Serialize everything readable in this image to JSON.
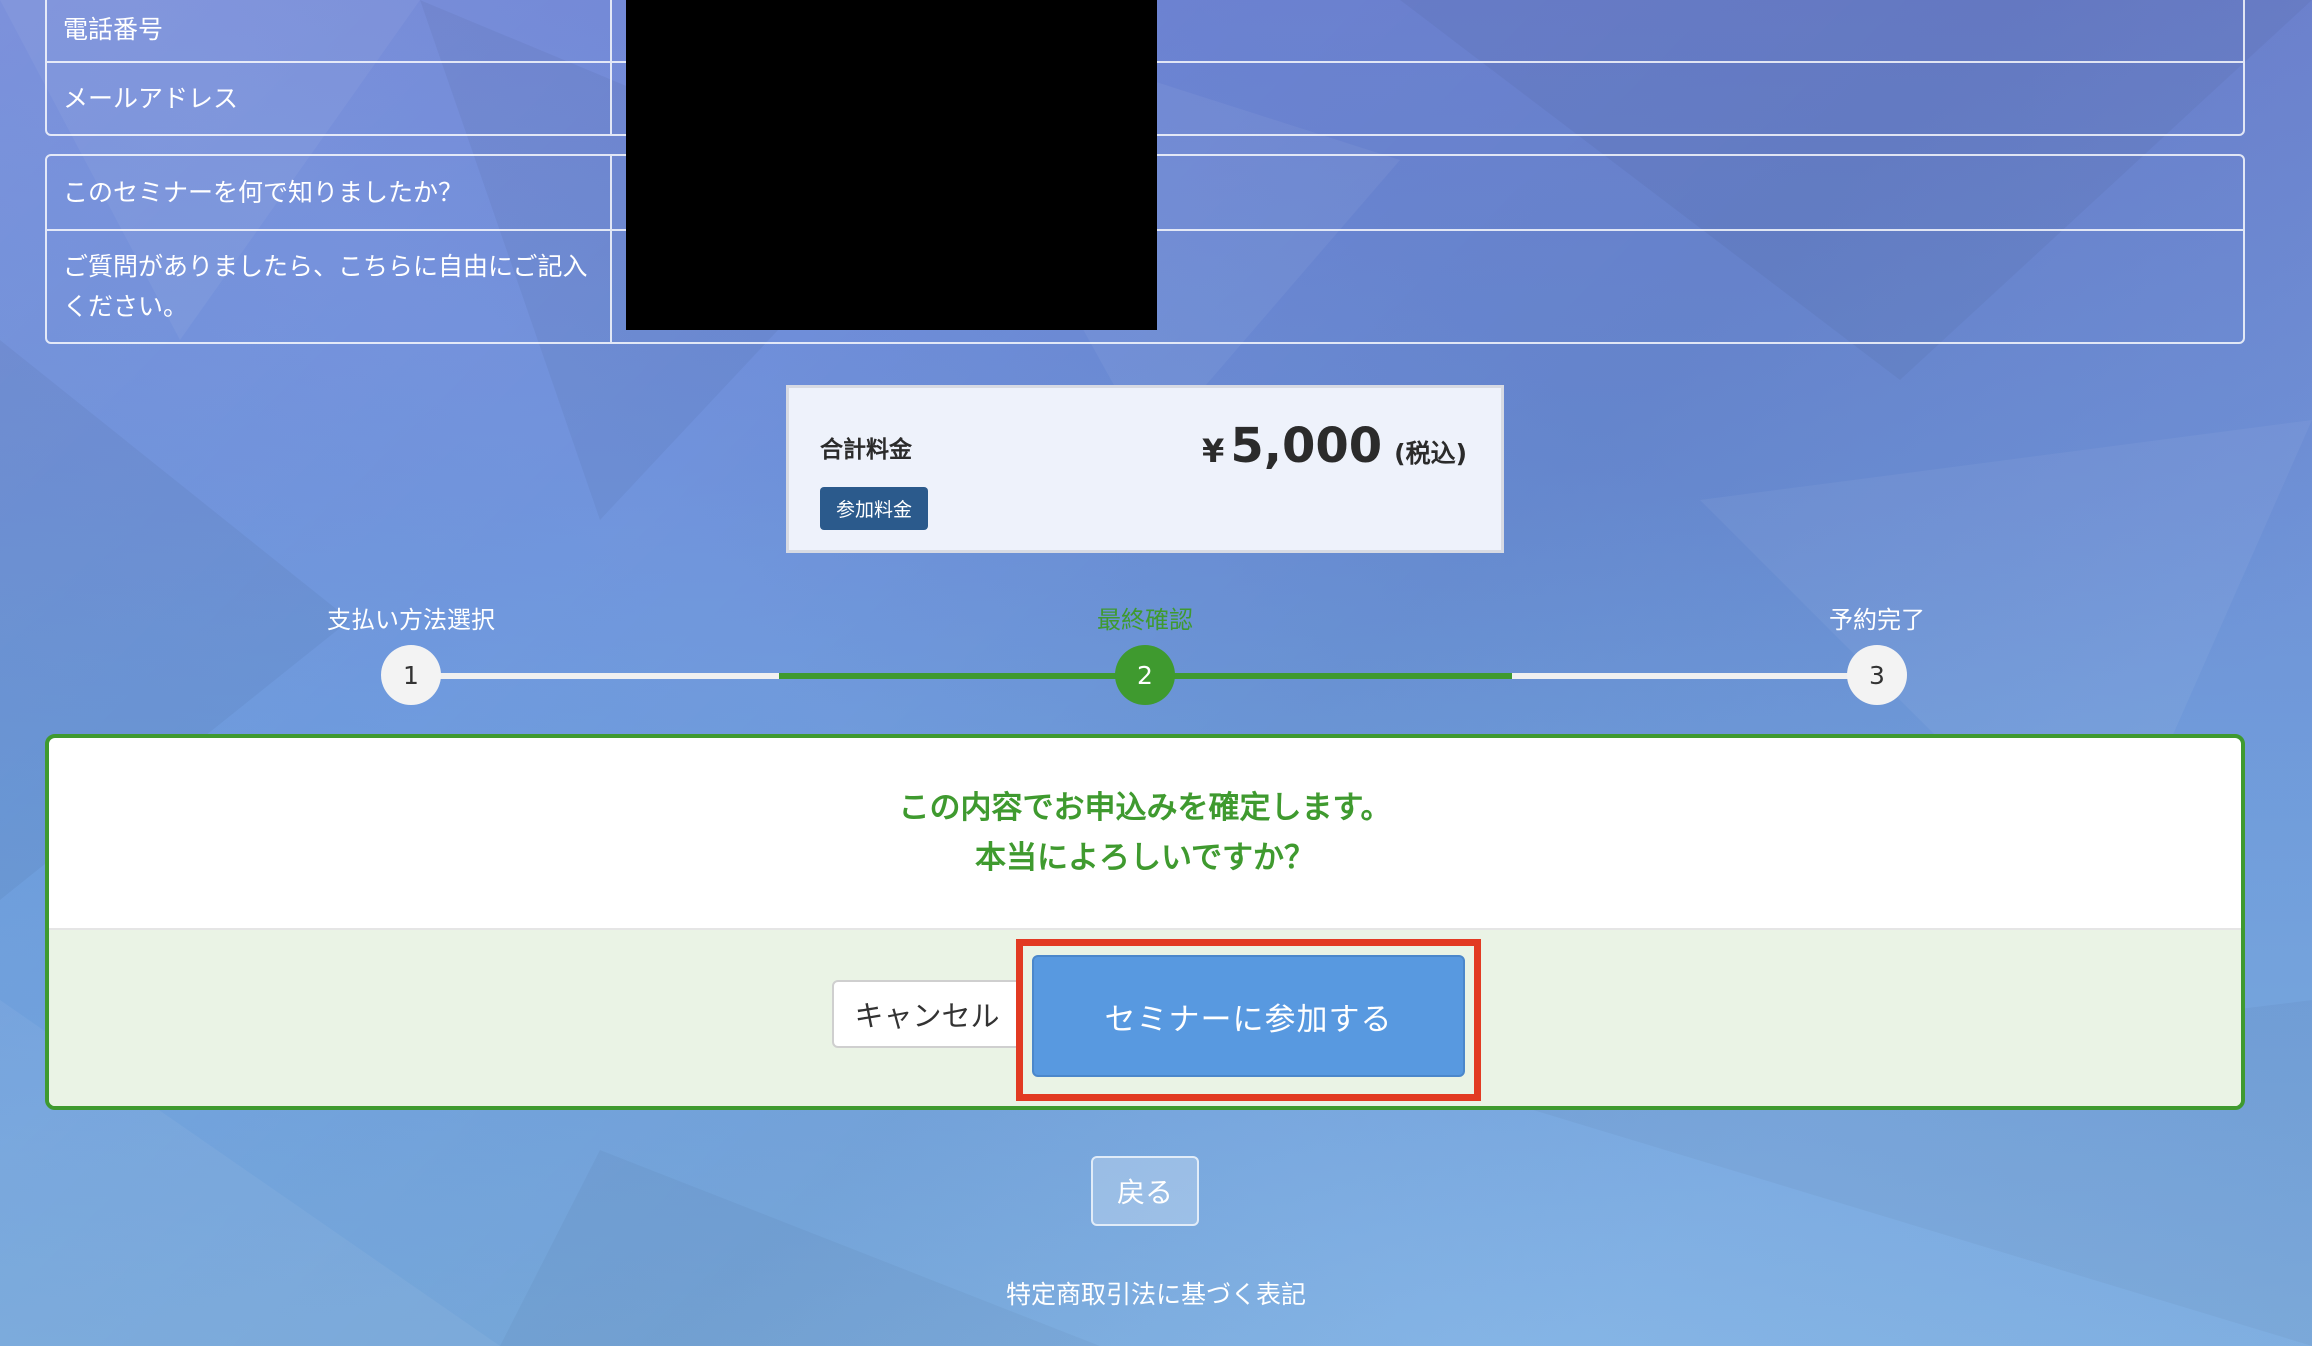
{
  "form_rows_top": [
    {
      "label": "電話番号"
    },
    {
      "label": "メールアドレス"
    }
  ],
  "form_rows_bottom": [
    {
      "label": "このセミナーを何で知りましたか？"
    },
    {
      "label": "ご質問がありましたら、こちらに自由にご記入ください。"
    }
  ],
  "price": {
    "label": "合計料金",
    "badge": "参加料金",
    "currency": "¥",
    "amount": "5,000",
    "tax": "(税込)"
  },
  "steps": [
    {
      "number": "1",
      "label": "支払い方法選択",
      "active": false
    },
    {
      "number": "2",
      "label": "最終確認",
      "active": true
    },
    {
      "number": "3",
      "label": "予約完了",
      "active": false
    }
  ],
  "confirm": {
    "line1": "この内容でお申込みを確定します。",
    "line2": "本当によろしいですか？",
    "cancel_label": "キャンセル",
    "join_label": "セミナーに参加する"
  },
  "back_label": "戻る",
  "footer_link": "特定商取引法に基づく表記",
  "colors": {
    "accent_green": "#3f9a2f",
    "join_button": "#5899e0",
    "highlight": "#e23a22",
    "badge": "#2b5a8c"
  }
}
